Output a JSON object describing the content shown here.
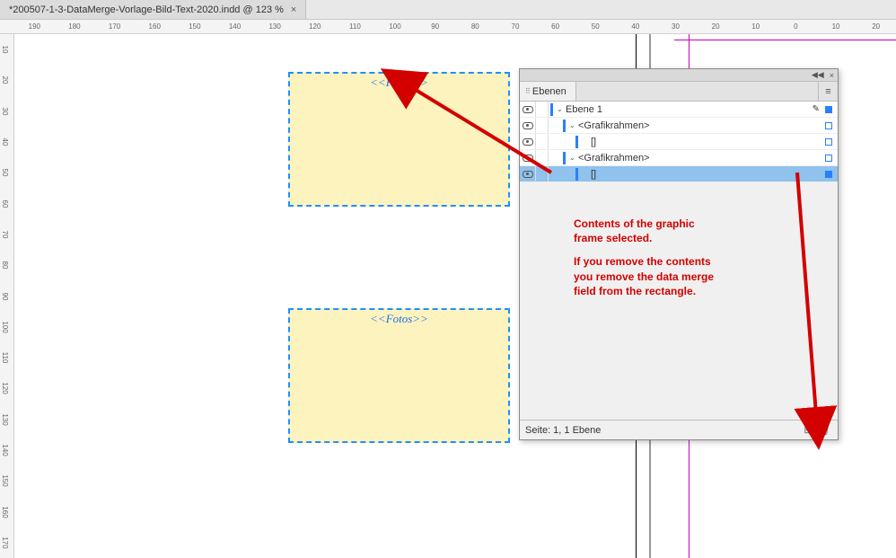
{
  "tab": {
    "title": "*200507-1-3-DataMerge-Vorlage-Bild-Text-2020.indd @ 123 %",
    "close_glyph": "×"
  },
  "ruler_h": [
    "190",
    "180",
    "170",
    "160",
    "150",
    "140",
    "130",
    "120",
    "110",
    "100",
    "90",
    "80",
    "70",
    "60",
    "50",
    "40",
    "30",
    "20",
    "10",
    "0",
    "10",
    "20"
  ],
  "ruler_v": [
    "10",
    "20",
    "30",
    "40",
    "50",
    "60",
    "70",
    "80",
    "90",
    "100",
    "110",
    "120",
    "130",
    "140",
    "150",
    "160",
    "170"
  ],
  "frames": [
    {
      "label": "<<Fotos>>"
    },
    {
      "label": "<<Fotos>>"
    }
  ],
  "panel": {
    "tab_label": "Ebenen",
    "collapse_glyph": "◀◀",
    "close_glyph": "×",
    "menu_glyph": "≡",
    "rows": [
      {
        "indent": 0,
        "disclose": "⌄",
        "label": "Ebene 1",
        "pen": true,
        "sq_filled": true
      },
      {
        "indent": 1,
        "disclose": "⌄",
        "label": "<Grafikrahmen>",
        "pen": false,
        "sq_filled": false
      },
      {
        "indent": 2,
        "disclose": "",
        "label": "[]",
        "pen": false,
        "sq_filled": false
      },
      {
        "indent": 1,
        "disclose": "⌄",
        "label": "<Grafikrahmen>",
        "pen": false,
        "sq_filled": false
      },
      {
        "indent": 2,
        "disclose": "",
        "label": "[]",
        "pen": false,
        "sq_filled": true,
        "selected": true
      }
    ],
    "status": "Seite: 1, 1 Ebene",
    "new_glyph": "⊞",
    "trash_glyph": "🗑"
  },
  "annotation": {
    "line1": "Contents of the graphic",
    "line2": "frame selected.",
    "line3": "If you remove the contents",
    "line4": "you remove the data merge",
    "line5": "field from the rectangle."
  }
}
